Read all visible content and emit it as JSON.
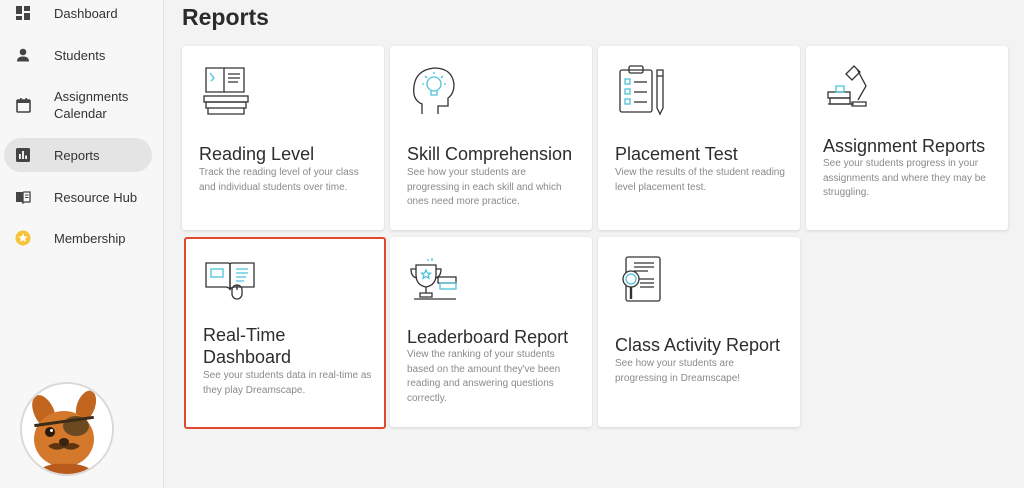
{
  "sidebar": {
    "items": [
      {
        "label": "Dashboard",
        "icon": "dashboard-icon",
        "active": false
      },
      {
        "label": "Students",
        "icon": "person-icon",
        "active": false
      },
      {
        "label": "Assignments Calendar",
        "icon": "calendar-icon",
        "active": false
      },
      {
        "label": "Reports",
        "icon": "bar-chart-icon",
        "active": true
      },
      {
        "label": "Resource Hub",
        "icon": "book-icon",
        "active": false
      },
      {
        "label": "Membership",
        "icon": "star-icon",
        "active": false
      }
    ],
    "avatar_icon": "character-avatar-icon"
  },
  "main": {
    "title": "Reports",
    "cards": [
      {
        "title": "Reading Level",
        "desc": "Track the reading level of your class and individual students over time.",
        "icon": "books-icon"
      },
      {
        "title": "Skill Comprehension",
        "desc": "See how your students are progressing in each skill and which ones need more practice.",
        "icon": "head-lightbulb-icon"
      },
      {
        "title": "Placement Test",
        "desc": "View the results of the student reading level placement test.",
        "icon": "clipboard-pencil-icon"
      },
      {
        "title": "Assignment Reports",
        "desc": "See your students progress in your assignments and where they may be struggling.",
        "icon": "desk-lamp-icon"
      },
      {
        "title": "Real-Time Dashboard",
        "desc": "See your students data in real-time as they play Dreamscape.",
        "icon": "open-book-mouse-icon"
      },
      {
        "title": "Leaderboard Report",
        "desc": "View the ranking of your students based on the amount they've been reading and answering questions correctly.",
        "icon": "trophy-icon"
      },
      {
        "title": "Class Activity Report",
        "desc": "See how your students are progressing in Dreamscape!",
        "icon": "tablet-magnifier-icon"
      }
    ]
  },
  "colors": {
    "highlight": "#e04a2c",
    "accent": "#4cc3d9",
    "membership_star": "#f5c23a"
  }
}
